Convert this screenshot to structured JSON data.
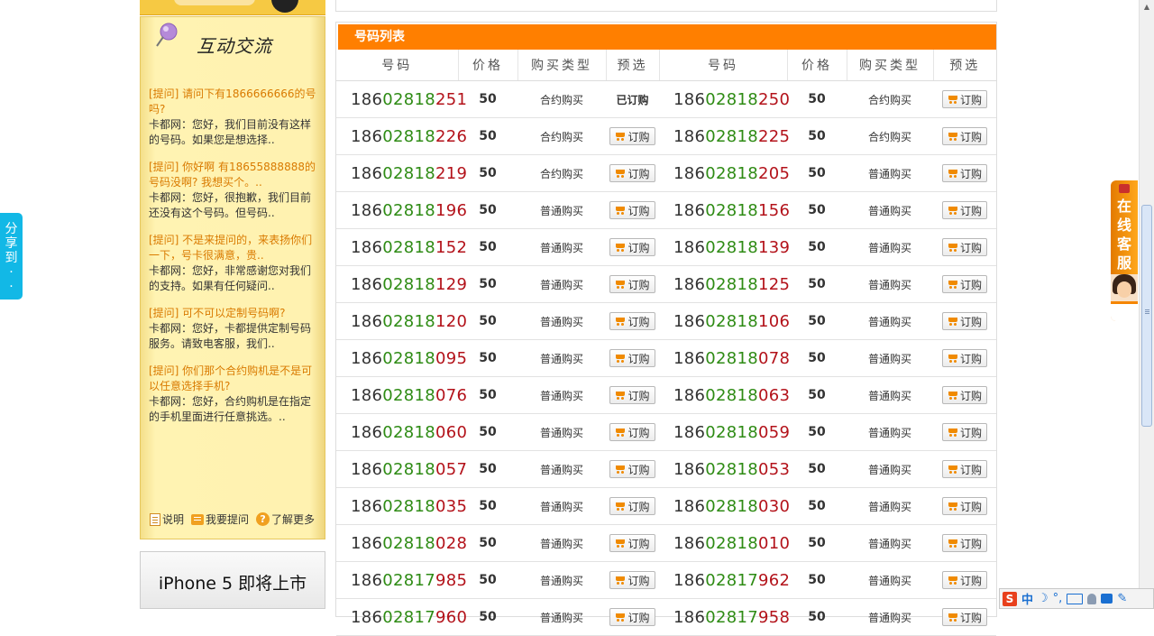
{
  "sidebar": {
    "title": "互动交流",
    "qa": [
      {
        "q": "[提问] 请问下有1866666666的号吗?",
        "a": "卡都网：您好，我们目前没有这样的号码。如果您是想选择.."
      },
      {
        "q": "[提问] 你好啊 有18655888888的号码没啊? 我想买个。..",
        "a": "卡都网：您好，很抱歉，我们目前还没有这个号码。但号码.."
      },
      {
        "q": "[提问] 不是来提问的，来表扬你们一下，号卡很满意，贵..",
        "a": "卡都网：您好，非常感谢您对我们的支持。如果有任何疑问.."
      },
      {
        "q": "[提问] 可不可以定制号码啊?",
        "a": "卡都网：您好，卡都提供定制号码服务。请致电客服，我们.."
      },
      {
        "q": "[提问] 你们那个合约购机是不是可以任意选择手机?",
        "a": "卡都网：您好，合约购机是在指定的手机里面进行任意挑选。.."
      }
    ],
    "footer": {
      "explain": "说明",
      "ask": "我要提问",
      "more": "了解更多"
    },
    "banner": "iPhone 5 即将上市"
  },
  "list": {
    "title": "号码列表",
    "headers": {
      "number": "号码",
      "price": "价格",
      "type": "购买类型",
      "reserve": "预选"
    },
    "order_label": "订购",
    "ordered_label": "已订购",
    "rows": [
      [
        {
          "p1": "186",
          "p2": "02818",
          "p3": "251",
          "price": "50",
          "type": "合约购买",
          "ordered": true
        },
        {
          "p1": "186",
          "p2": "02818",
          "p3": "250",
          "price": "50",
          "type": "合约购买",
          "ordered": false
        }
      ],
      [
        {
          "p1": "186",
          "p2": "02818",
          "p3": "226",
          "price": "50",
          "type": "合约购买",
          "ordered": false
        },
        {
          "p1": "186",
          "p2": "02818",
          "p3": "225",
          "price": "50",
          "type": "合约购买",
          "ordered": false
        }
      ],
      [
        {
          "p1": "186",
          "p2": "02818",
          "p3": "219",
          "price": "50",
          "type": "合约购买",
          "ordered": false
        },
        {
          "p1": "186",
          "p2": "02818",
          "p3": "205",
          "price": "50",
          "type": "普通购买",
          "ordered": false
        }
      ],
      [
        {
          "p1": "186",
          "p2": "02818",
          "p3": "196",
          "price": "50",
          "type": "普通购买",
          "ordered": false
        },
        {
          "p1": "186",
          "p2": "02818",
          "p3": "156",
          "price": "50",
          "type": "普通购买",
          "ordered": false
        }
      ],
      [
        {
          "p1": "186",
          "p2": "02818",
          "p3": "152",
          "price": "50",
          "type": "普通购买",
          "ordered": false
        },
        {
          "p1": "186",
          "p2": "02818",
          "p3": "139",
          "price": "50",
          "type": "普通购买",
          "ordered": false
        }
      ],
      [
        {
          "p1": "186",
          "p2": "02818",
          "p3": "129",
          "price": "50",
          "type": "普通购买",
          "ordered": false
        },
        {
          "p1": "186",
          "p2": "02818",
          "p3": "125",
          "price": "50",
          "type": "普通购买",
          "ordered": false
        }
      ],
      [
        {
          "p1": "186",
          "p2": "02818",
          "p3": "120",
          "price": "50",
          "type": "普通购买",
          "ordered": false
        },
        {
          "p1": "186",
          "p2": "02818",
          "p3": "106",
          "price": "50",
          "type": "普通购买",
          "ordered": false
        }
      ],
      [
        {
          "p1": "186",
          "p2": "02818",
          "p3": "095",
          "price": "50",
          "type": "普通购买",
          "ordered": false
        },
        {
          "p1": "186",
          "p2": "02818",
          "p3": "078",
          "price": "50",
          "type": "普通购买",
          "ordered": false
        }
      ],
      [
        {
          "p1": "186",
          "p2": "02818",
          "p3": "076",
          "price": "50",
          "type": "普通购买",
          "ordered": false
        },
        {
          "p1": "186",
          "p2": "02818",
          "p3": "063",
          "price": "50",
          "type": "普通购买",
          "ordered": false
        }
      ],
      [
        {
          "p1": "186",
          "p2": "02818",
          "p3": "060",
          "price": "50",
          "type": "普通购买",
          "ordered": false
        },
        {
          "p1": "186",
          "p2": "02818",
          "p3": "059",
          "price": "50",
          "type": "普通购买",
          "ordered": false
        }
      ],
      [
        {
          "p1": "186",
          "p2": "02818",
          "p3": "057",
          "price": "50",
          "type": "普通购买",
          "ordered": false
        },
        {
          "p1": "186",
          "p2": "02818",
          "p3": "053",
          "price": "50",
          "type": "普通购买",
          "ordered": false
        }
      ],
      [
        {
          "p1": "186",
          "p2": "02818",
          "p3": "035",
          "price": "50",
          "type": "普通购买",
          "ordered": false
        },
        {
          "p1": "186",
          "p2": "02818",
          "p3": "030",
          "price": "50",
          "type": "普通购买",
          "ordered": false
        }
      ],
      [
        {
          "p1": "186",
          "p2": "02818",
          "p3": "028",
          "price": "50",
          "type": "普通购买",
          "ordered": false
        },
        {
          "p1": "186",
          "p2": "02818",
          "p3": "010",
          "price": "50",
          "type": "普通购买",
          "ordered": false
        }
      ],
      [
        {
          "p1": "186",
          "p2": "02817",
          "p3": "985",
          "price": "50",
          "type": "普通购买",
          "ordered": false
        },
        {
          "p1": "186",
          "p2": "02817",
          "p3": "962",
          "price": "50",
          "type": "普通购买",
          "ordered": false
        }
      ],
      [
        {
          "p1": "186",
          "p2": "02817",
          "p3": "960",
          "price": "50",
          "type": "普通购买",
          "ordered": false
        },
        {
          "p1": "186",
          "p2": "02817",
          "p3": "958",
          "price": "50",
          "type": "普通购买",
          "ordered": false
        }
      ]
    ]
  },
  "share_tab": {
    "label": "分享到"
  },
  "service_tab": {
    "label": "在线客服"
  },
  "ime": {
    "logo": "S",
    "mode": "中",
    "moon": "☽",
    "punct": "°,"
  },
  "colors": {
    "accent": "#ff7f00",
    "number_green": "#2e8b14",
    "number_red": "#b3121a",
    "share": "#12b8e6"
  }
}
